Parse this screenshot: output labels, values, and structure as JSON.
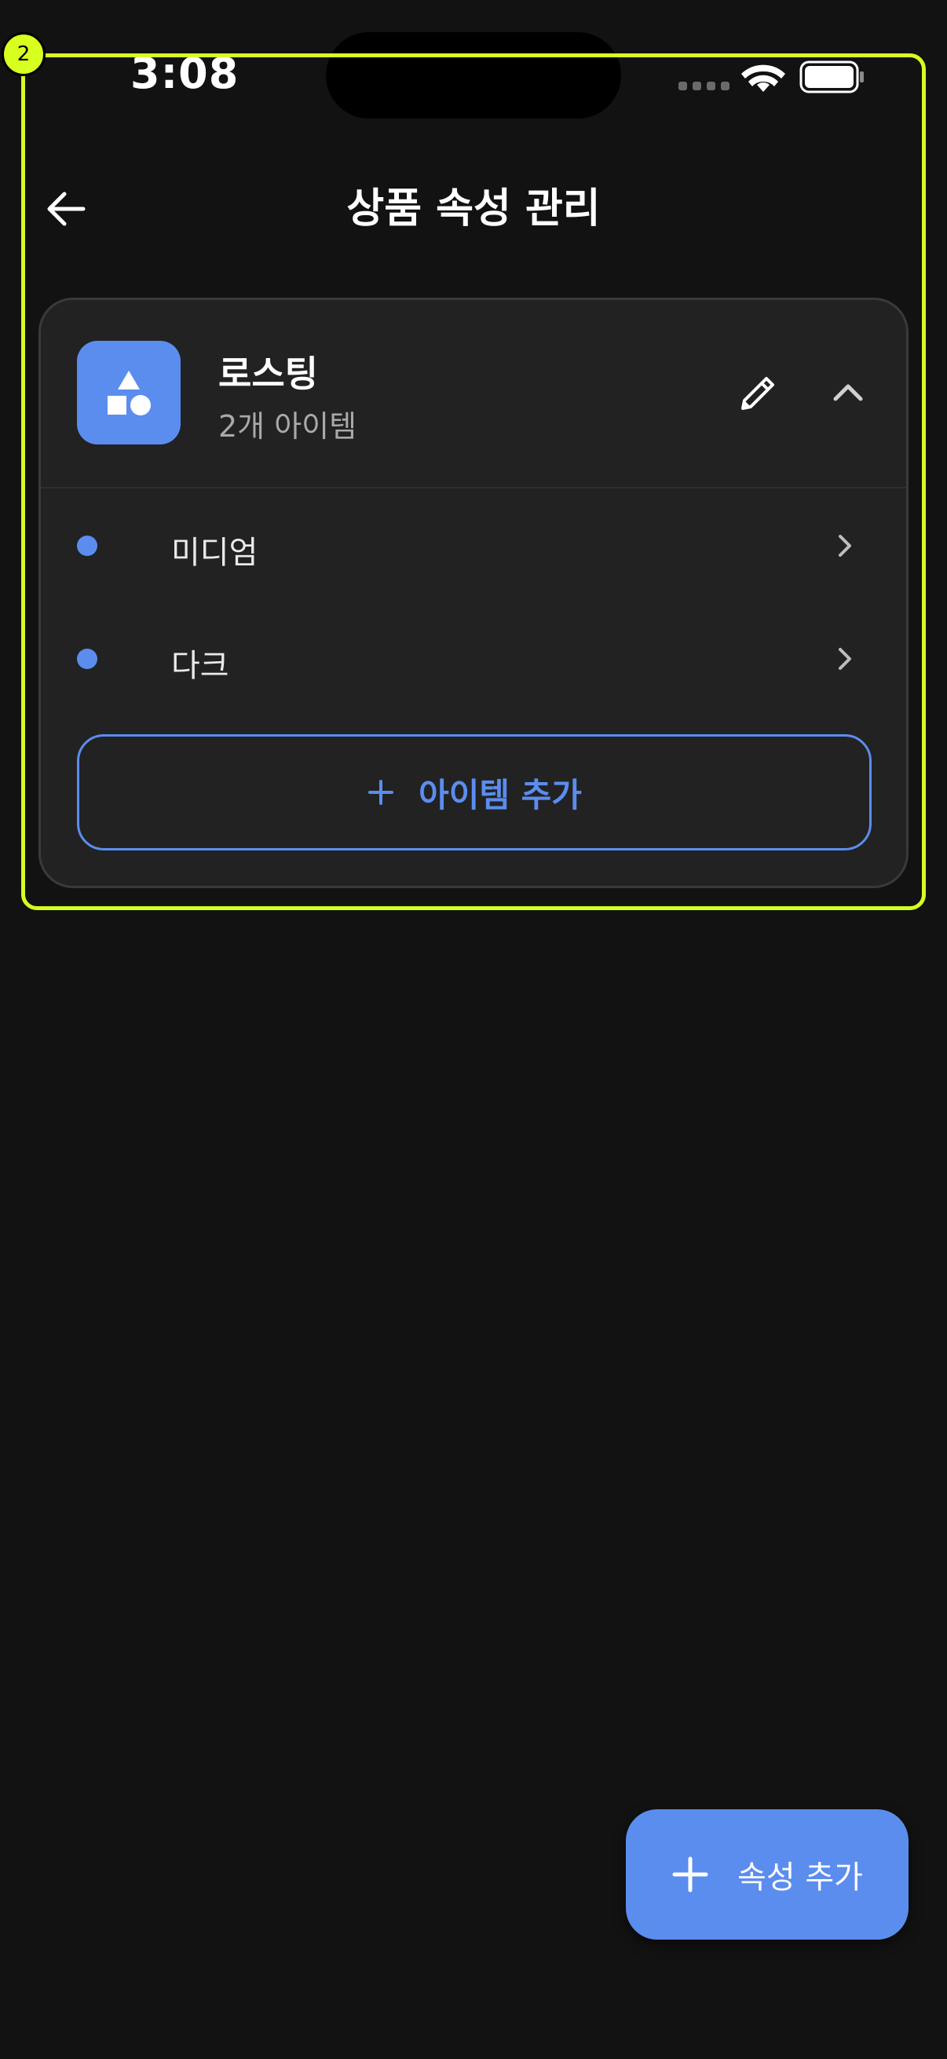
{
  "status_bar": {
    "time": "3:08"
  },
  "header": {
    "title": "상품 속성 관리"
  },
  "attribute_card": {
    "name": "로스팅",
    "count_text": "2개 아이템",
    "items": [
      {
        "label": "미디엄"
      },
      {
        "label": "다크"
      }
    ],
    "add_item_label": "아이템 추가"
  },
  "fab": {
    "label": "속성 추가"
  },
  "highlight": {
    "badge": "2"
  },
  "colors": {
    "accent": "#5b8def",
    "background": "#121212",
    "card": "#222222",
    "highlight": "#d7ff1f"
  }
}
